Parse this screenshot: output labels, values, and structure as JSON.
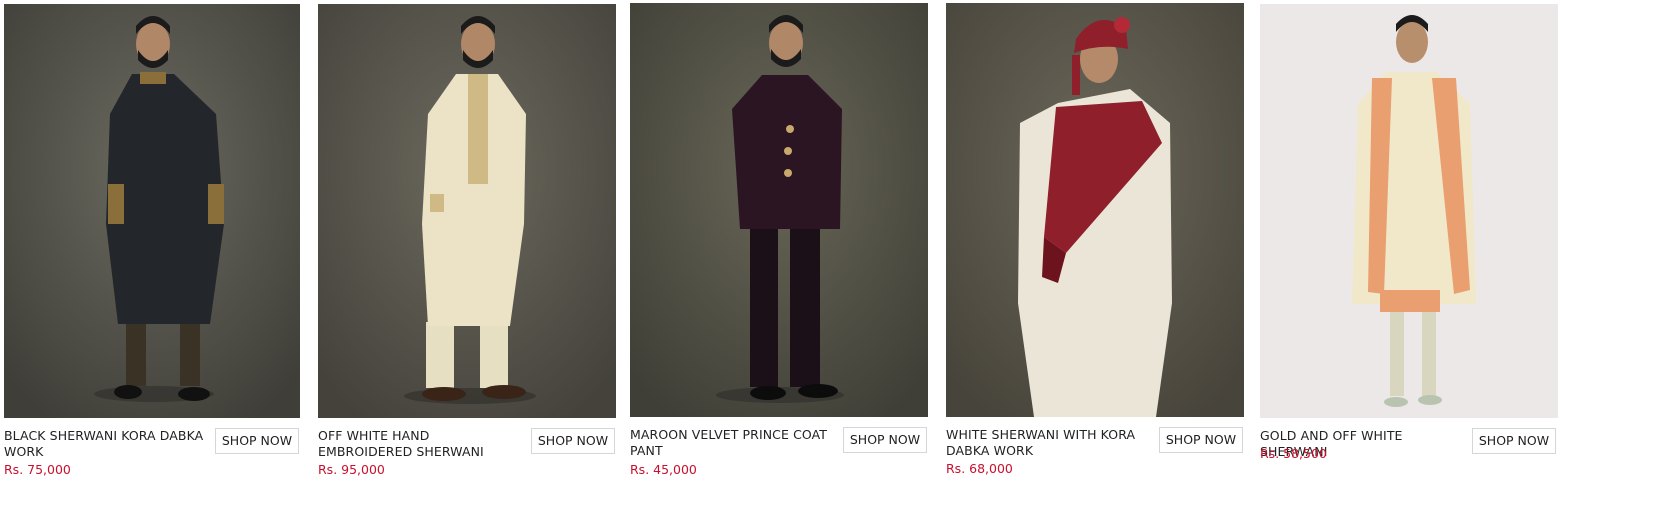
{
  "products": [
    {
      "title": "BLACK SHERWANI KORA DABKA WORK",
      "price": "Rs. 75,000",
      "button": "SHOP NOW"
    },
    {
      "title": "OFF WHITE HAND EMBROIDERED SHERWANI",
      "price": "Rs. 95,000",
      "button": "SHOP NOW"
    },
    {
      "title": "MAROON VELVET PRINCE COAT PANT",
      "price": "Rs. 45,000",
      "button": "SHOP NOW"
    },
    {
      "title": "WHITE SHERWANI WITH KORA DABKA WORK",
      "price": "Rs. 68,000",
      "button": "SHOP NOW"
    },
    {
      "title": "GOLD AND OFF WHITE SHERWANI",
      "price": "Rs. 58,500",
      "button": "SHOP NOW"
    }
  ],
  "colors": {
    "price": "#c8102e",
    "text": "#222222",
    "button_border": "#d6d6d6"
  }
}
